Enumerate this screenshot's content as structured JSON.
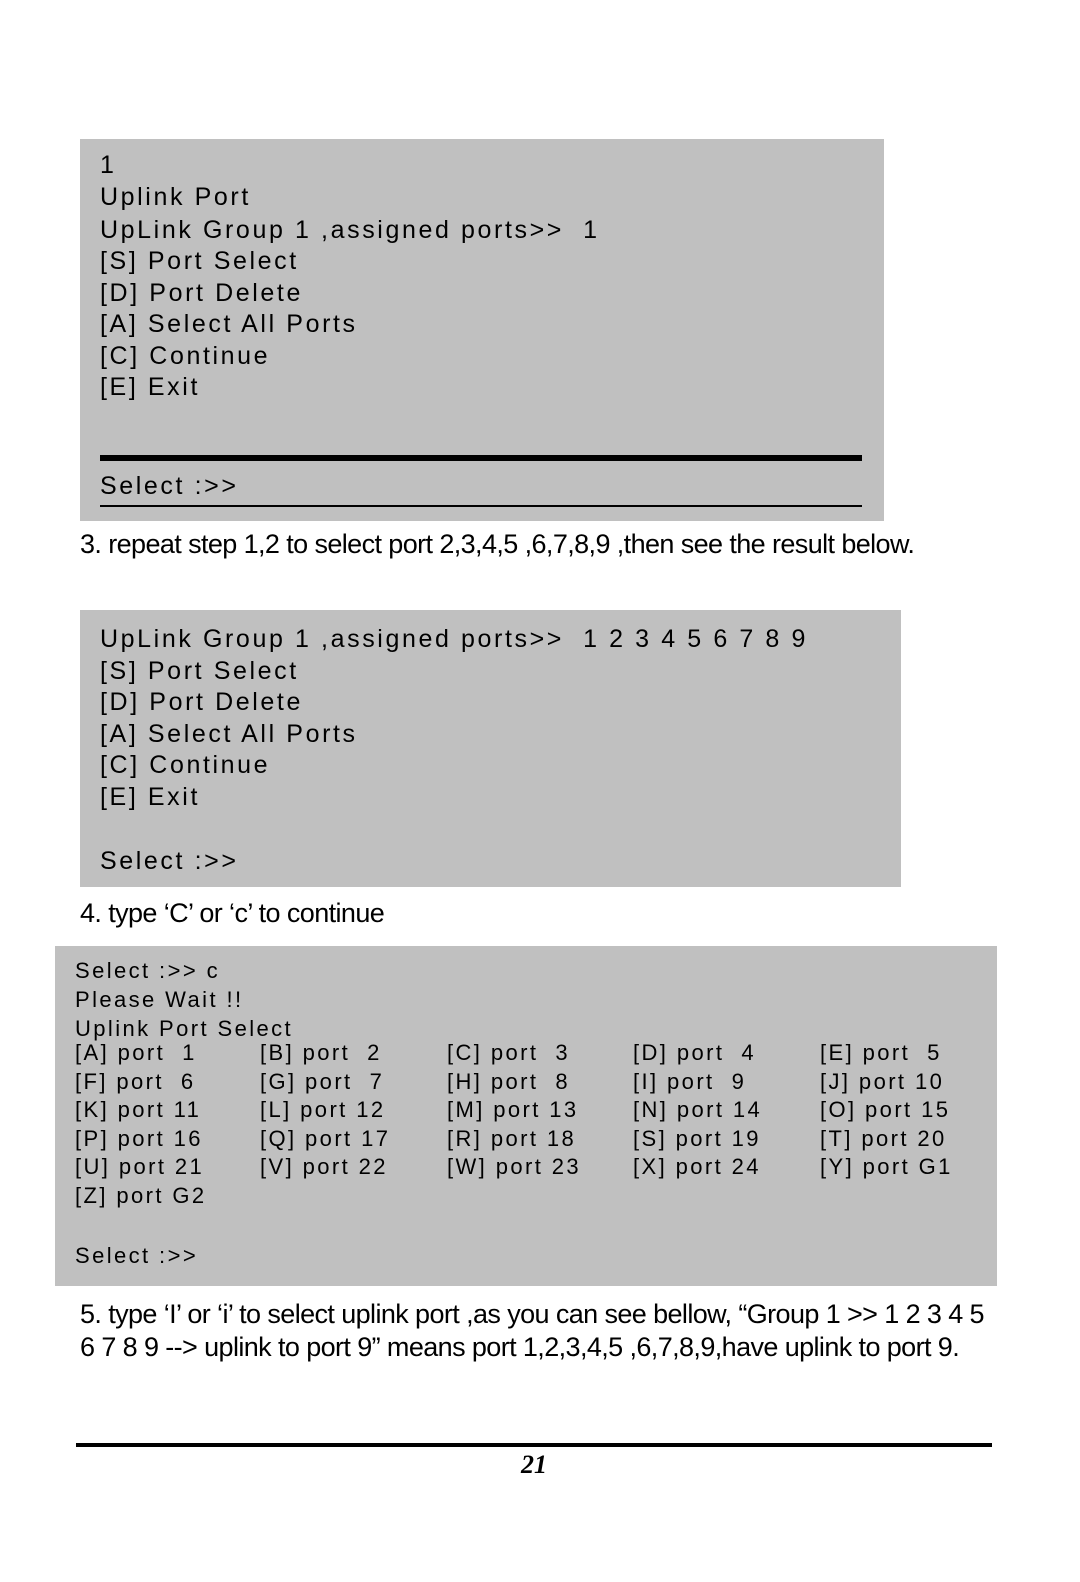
{
  "box1": {
    "lines": [
      "1",
      "Uplink Port",
      "UpLink Group 1 ,assigned ports>>  1",
      "[S] Port Select",
      "[D] Port Delete",
      "[A] Select All Ports",
      "[C] Continue",
      "[E] Exit"
    ],
    "prompt": "Select :>>"
  },
  "step3": "3. repeat step 1,2 to select port 2,3,4,5 ,6,7,8,9 ,then see the result below.",
  "box2": {
    "lines": [
      "UpLink Group 1 ,assigned ports>>  1 2 3 4 5 6 7 8 9",
      "[S] Port Select",
      "[D] Port Delete",
      "[A] Select All Ports",
      "[C] Continue",
      "[E] Exit"
    ],
    "prompt": "Select :>>"
  },
  "step4": "4. type ‘C’ or ‘c’ to continue",
  "box3": {
    "header_lines": [
      "Select :>> c",
      "Please Wait !!",
      "Uplink Port Select"
    ],
    "ports": [
      [
        "[A] port  1",
        "[B] port  2",
        "[C] port  3",
        "[D] port  4",
        "[E] port  5"
      ],
      [
        "[F] port  6",
        "[G] port  7",
        "[H] port  8",
        "[I] port  9",
        "[J] port 10"
      ],
      [
        "[K] port 11",
        "[L] port 12",
        "[M] port 13",
        "[N] port 14",
        "[O] port 15"
      ],
      [
        "[P] port 16",
        "[Q] port 17",
        "[R] port 18",
        "[S] port 19",
        "[T] port 20"
      ],
      [
        "[U] port 21",
        "[V] port 22",
        "[W] port 23",
        "[X] port 24",
        "[Y] port G1"
      ],
      [
        "[Z] port G2"
      ]
    ],
    "prompt": "Select :>>"
  },
  "step5": "5. type ‘I’ or ‘i’ to select uplink port ,as you can see bellow, “Group 1 >> 1 2 3 4 5 6 7 8 9 --> uplink to port 9” means port 1,2,3,4,5 ,6,7,8,9,have uplink to port 9.",
  "page_number": "21"
}
